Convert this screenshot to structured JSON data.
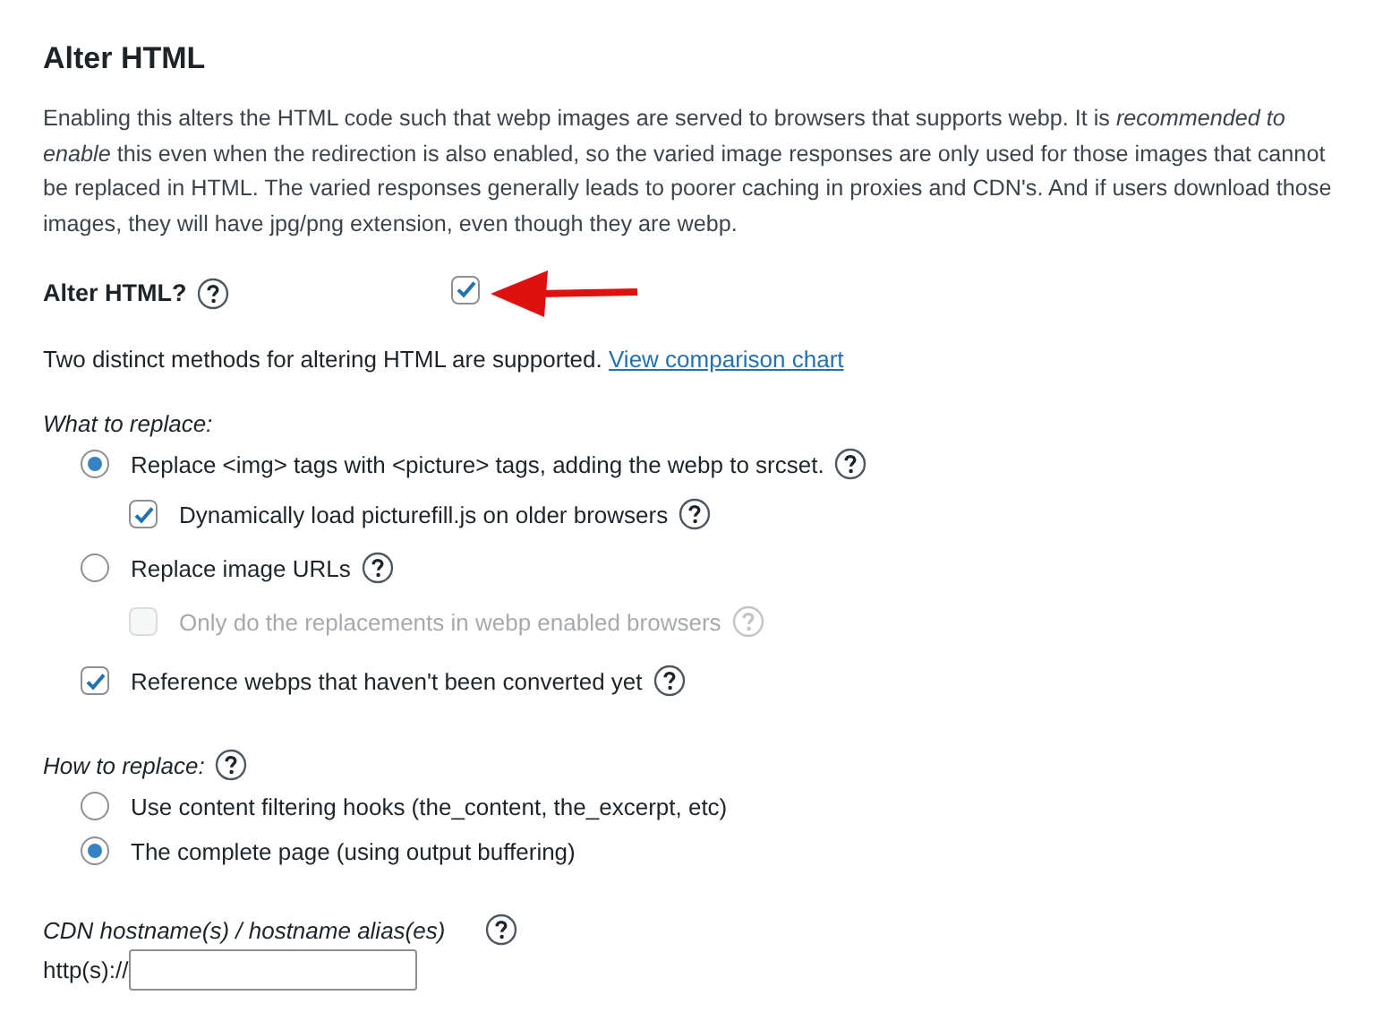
{
  "section": {
    "title": "Alter HTML",
    "description": "Enabling this alters the HTML code such that webp images are served to browsers that supports webp. It is *recommended to enable* this even when the redirection is also enabled, so the varied image responses are only used for those images that cannot be replaced in HTML. The varied responses generally leads to poorer caching in proxies and CDN's. And if users download those images, they will have jpg/png extension, even though they are webp."
  },
  "alter_html": {
    "label": "Alter HTML?",
    "help": true,
    "checked": true
  },
  "methods_note": {
    "text": "Two distinct methods for altering HTML are supported.",
    "link": "View comparison chart"
  },
  "what_to_replace": {
    "label": "What to replace:",
    "options": [
      {
        "kind": "radio",
        "label": "Replace <img> tags with <picture> tags, adding the webp to srcset.",
        "selected": true,
        "help": true,
        "children": [
          {
            "kind": "checkbox",
            "label": "Dynamically load picturefill.js on older browsers",
            "checked": true,
            "help": true
          }
        ]
      },
      {
        "kind": "radio",
        "label": "Replace image URLs",
        "selected": false,
        "help": true,
        "children": [
          {
            "kind": "checkbox",
            "label": "Only do the replacements in webp enabled browsers",
            "checked": false,
            "disabled": true,
            "help": true
          }
        ]
      },
      {
        "kind": "checkbox",
        "label": "Reference webps that haven't been converted yet",
        "checked": true,
        "help": true
      }
    ]
  },
  "how_to_replace": {
    "label": "How to replace:",
    "help": true,
    "options": [
      {
        "kind": "radio",
        "label": "Use content filtering hooks (the_content, the_excerpt, etc)",
        "selected": false
      },
      {
        "kind": "radio",
        "label": "The complete page (using output buffering)",
        "selected": true
      }
    ]
  },
  "cdn": {
    "label": "CDN hostname(s) / hostname alias(es)",
    "help": true,
    "prefix": "http(s)://"
  }
}
